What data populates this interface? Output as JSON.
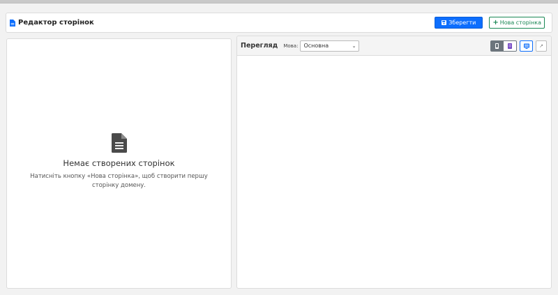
{
  "header": {
    "title": "Редактор сторінок",
    "save_label": "Зберегти",
    "new_page_label": "Нова сторінка"
  },
  "empty_state": {
    "title": "Немає створених сторінок",
    "text": "Натисніть кнопку «Нова сторінка», щоб створити першу сторінку домену."
  },
  "preview": {
    "title": "Перегляд",
    "language_label": "Мова:",
    "language_value": "Основна",
    "devices": [
      "phone-icon",
      "tablet-icon",
      "desktop-icon"
    ],
    "active_device": "phone-icon"
  },
  "colors": {
    "primary": "#0d6efd",
    "success": "#198754",
    "secondary": "#6c757d"
  }
}
